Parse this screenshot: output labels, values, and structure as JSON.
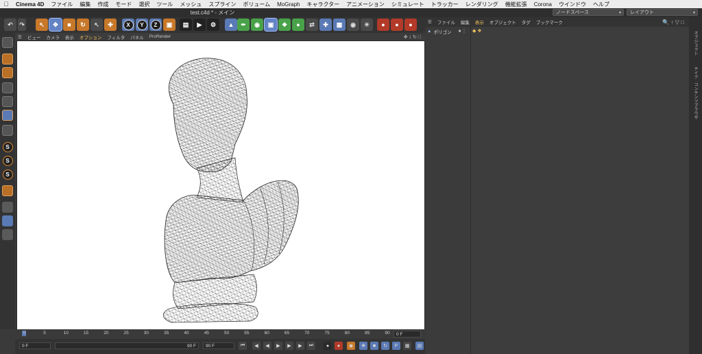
{
  "menubar": {
    "items": [
      "Cinema 4D",
      "ファイル",
      "編集",
      "作成",
      "モード",
      "選択",
      "ツール",
      "メッシュ",
      "スプライン",
      "ボリューム",
      "MoGraph",
      "キャラクター",
      "アニメーション",
      "シミュレート",
      "トラッカー",
      "レンダリング",
      "機能拡張",
      "Corona",
      "ウインドウ",
      "ヘルプ"
    ]
  },
  "titlebar": {
    "title": "test.c4d * - メイン",
    "node_space": "ノードスペース",
    "layout": "レイアウト"
  },
  "toolbar": {
    "axis_x": "X",
    "axis_y": "Y",
    "axis_z": "Z"
  },
  "lefttools": {
    "s1": "S",
    "s2": "S",
    "s3": "S"
  },
  "viewport_menu": {
    "items": [
      "ビュー",
      "カメラ",
      "表示",
      "オプション",
      "フィルタ",
      "パネル",
      "ProRender"
    ]
  },
  "timeline": {
    "ticks": [
      "0",
      "5",
      "10",
      "15",
      "20",
      "25",
      "30",
      "35",
      "40",
      "45",
      "50",
      "55",
      "60",
      "65",
      "70",
      "75",
      "80",
      "85",
      "90"
    ],
    "current_frame": "0 F"
  },
  "playback": {
    "start": "0 F",
    "range_end": "90 F",
    "end": "90 F"
  },
  "object_manager": {
    "menu": [
      "ファイル",
      "編集",
      "表示",
      "オブジェクト",
      "タグ",
      "ブックマーク"
    ],
    "object_name": "ポリゴン"
  },
  "right_strip": {
    "tabs": [
      "オブジェクト",
      "テイク",
      "コンテンツブラウザ"
    ]
  },
  "colors": {
    "accent": "#5a7ab5",
    "orange": "#c7782a",
    "menu_highlight": "#f2c25a"
  }
}
